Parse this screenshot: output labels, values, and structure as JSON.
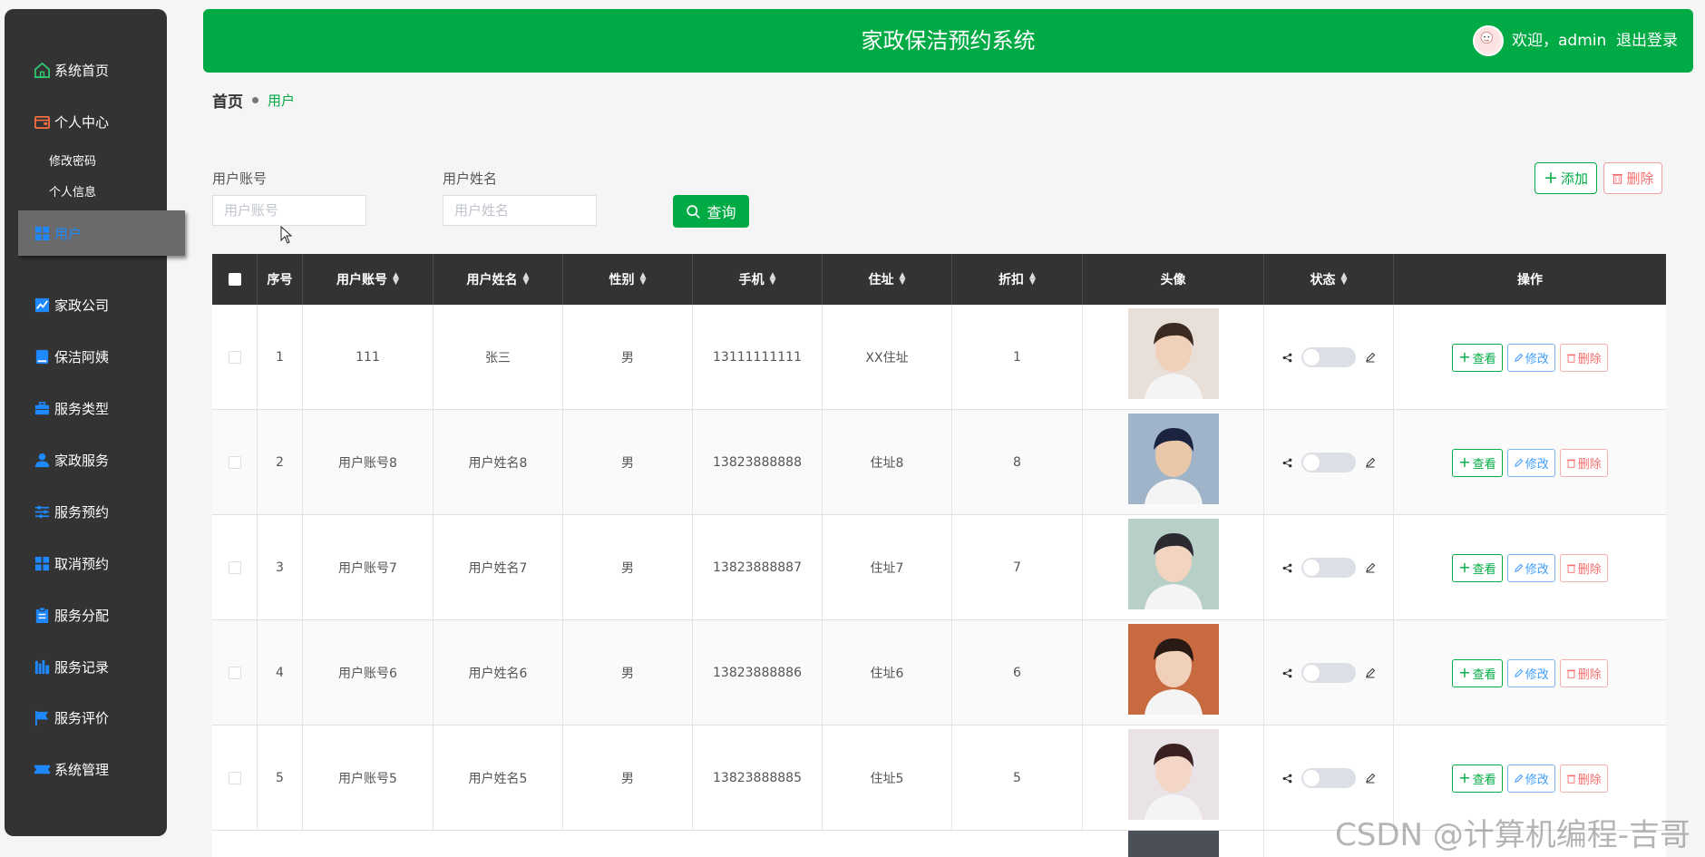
{
  "app": {
    "title": "家政保洁预约系统",
    "welcome": "欢迎，admin",
    "logout": "退出登录"
  },
  "sidebar": {
    "items": [
      {
        "label": "系统首页",
        "icon": "home-icon"
      },
      {
        "label": "个人中心",
        "icon": "wallet-icon"
      },
      {
        "label": "用户",
        "icon": "grid-icon",
        "active": true
      },
      {
        "label": "家政公司",
        "icon": "chart-icon"
      },
      {
        "label": "保洁阿姨",
        "icon": "book-icon"
      },
      {
        "label": "服务类型",
        "icon": "briefcase-icon"
      },
      {
        "label": "家政服务",
        "icon": "user-icon"
      },
      {
        "label": "服务预约",
        "icon": "sliders-icon"
      },
      {
        "label": "取消预约",
        "icon": "grid-icon"
      },
      {
        "label": "服务分配",
        "icon": "clipboard-icon"
      },
      {
        "label": "服务记录",
        "icon": "bars-icon"
      },
      {
        "label": "服务评价",
        "icon": "flag-icon"
      },
      {
        "label": "系统管理",
        "icon": "ticket-icon"
      }
    ],
    "sub_items": [
      "修改密码",
      "个人信息"
    ]
  },
  "breadcrumb": {
    "home": "首页",
    "current": "用户"
  },
  "search": {
    "account_label": "用户账号",
    "account_placeholder": "用户账号",
    "name_label": "用户姓名",
    "name_placeholder": "用户姓名",
    "query_label": "查询"
  },
  "toolbar": {
    "add_label": "添加",
    "delete_label": "删除"
  },
  "table": {
    "columns": [
      "序号",
      "用户账号",
      "用户姓名",
      "性别",
      "手机",
      "住址",
      "折扣",
      "头像",
      "状态",
      "操作"
    ],
    "rows": [
      {
        "index": "1",
        "account": "111",
        "name": "张三",
        "gender": "男",
        "phone": "13111111111",
        "address": "XX住址",
        "discount": "1"
      },
      {
        "index": "2",
        "account": "用户账号8",
        "name": "用户姓名8",
        "gender": "男",
        "phone": "13823888888",
        "address": "住址8",
        "discount": "8"
      },
      {
        "index": "3",
        "account": "用户账号7",
        "name": "用户姓名7",
        "gender": "男",
        "phone": "13823888887",
        "address": "住址7",
        "discount": "7"
      },
      {
        "index": "4",
        "account": "用户账号6",
        "name": "用户姓名6",
        "gender": "男",
        "phone": "13823888886",
        "address": "住址6",
        "discount": "6"
      },
      {
        "index": "5",
        "account": "用户账号5",
        "name": "用户姓名5",
        "gender": "男",
        "phone": "13823888885",
        "address": "住址5",
        "discount": "5"
      }
    ],
    "actions": {
      "view": "查看",
      "edit": "修改",
      "delete": "删除"
    }
  },
  "watermark": "CSDN @计算机编程-吉哥",
  "colors": {
    "primary": "#00aa44",
    "sidebar": "#333333",
    "active_text": "#1e88ff",
    "danger": "#f56c6c",
    "info": "#409eff"
  }
}
